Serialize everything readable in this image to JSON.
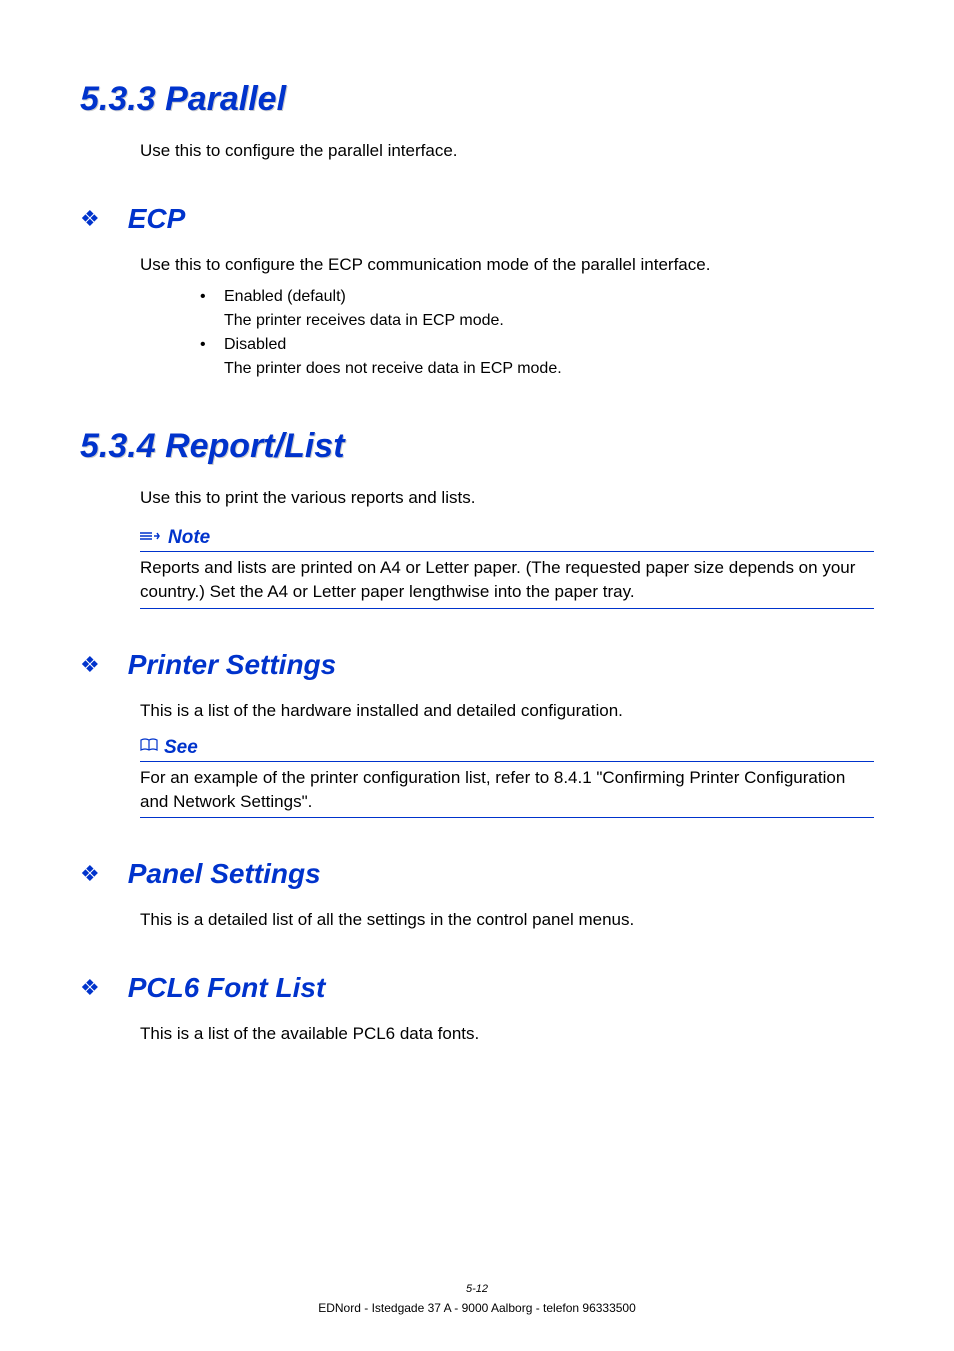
{
  "section1": {
    "heading": "5.3.3   Parallel",
    "intro": "Use this to configure the parallel interface.",
    "sub1": {
      "title": "ECP",
      "desc": "Use this to configure the ECP communication mode of the parallel interface.",
      "bullets": {
        "b1": "Enabled (default)",
        "b1sub": "The printer receives data in ECP mode.",
        "b2": "Disabled",
        "b2sub": "The printer does not receive data in ECP mode."
      }
    }
  },
  "section2": {
    "heading": "5.3.4   Report/List",
    "intro": "Use this to print the various reports and lists.",
    "note": {
      "label": "Note",
      "text": "Reports and lists are printed on A4 or Letter paper. (The requested paper size depends on your country.) Set the A4 or Letter paper lengthwise into the paper tray."
    },
    "sub1": {
      "title": "Printer Settings",
      "desc": "This is a list of the hardware installed and detailed configuration.",
      "see": {
        "label": "See",
        "text": "For an example of the printer configuration list, refer to 8.4.1 \"Confirming Printer Configuration and Network Settings\"."
      }
    },
    "sub2": {
      "title": "Panel Settings",
      "desc": "This is a detailed list of all the settings in the control panel menus."
    },
    "sub3": {
      "title": "PCL6 Font List",
      "desc": "This is a list of the available PCL6 data fonts."
    }
  },
  "footer": {
    "page": "5-12",
    "line": "EDNord - Istedgade 37 A - 9000 Aalborg - telefon 96333500"
  }
}
